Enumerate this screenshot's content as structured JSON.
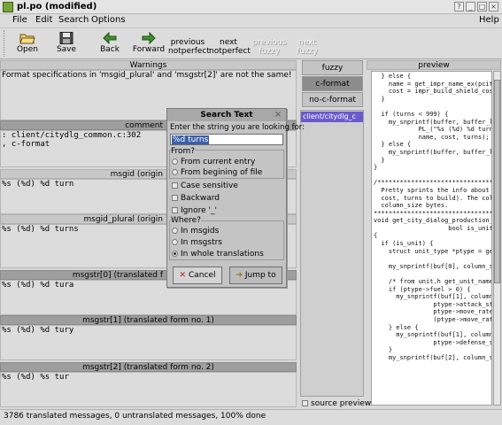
{
  "window": {
    "title": "pl.po (modified)",
    "buttons": [
      "?",
      "_",
      "□",
      "×"
    ]
  },
  "menubar": {
    "items": [
      {
        "label": "File"
      },
      {
        "label": "Edit"
      },
      {
        "label": "Search"
      },
      {
        "label": "Options"
      }
    ],
    "help": "Help"
  },
  "toolbar": {
    "open": "Open",
    "save": "Save",
    "back": "Back",
    "forward": "Forward",
    "prev_notperfect_1": "previous",
    "prev_notperfect_2": "notperfect",
    "next_notperfect_1": "next",
    "next_notperfect_2": "notperfect",
    "prev_fuzzy_1": "previous",
    "prev_fuzzy_2": "fuzzy",
    "next_fuzzy_1": "next",
    "next_fuzzy_2": "fuzzy"
  },
  "panes": {
    "warnings_header": "Warnings",
    "warnings_text": "Format specifications in 'msgid_plural' and 'msgstr[2]' are not the same!",
    "comments_header": "comment",
    "comment_line1": ": client/citydlg_common.c:302",
    "comment_line2": ", c-format",
    "msgid_header": "msgid (origin",
    "msgid_text": "%s (%d) %d turn",
    "msgid_plural_header": "msgid_plural (origin",
    "msgid_plural_text": "%s (%d) %d turns",
    "msgstr0_header": "msgstr[0] (translated f",
    "msgstr0_text": "%s (%d) %d tura",
    "msgstr1_header": "msgstr[1] (translated form no. 1)",
    "msgstr1_text": "%s (%d) %d tury",
    "msgstr2_header": "msgstr[2] (translated form no. 2)",
    "msgstr2_text": "%s (%d) %s tur"
  },
  "rightpanel": {
    "fuzzy": "fuzzy",
    "c_format": "c-format",
    "no_c_format": "no-c-format",
    "file_entry": "client/citydlg_c",
    "source_preview": "source preview",
    "preview_header": "preview",
    "preview_code": "  } else {\n    name = get_impr_name_ex(pcity,\n    cost = impr_build_shield_cost(id);\n  }\n\n  if (turns < 999) {\n    my_snprintf(buffer, buffer_len,\n            PL_(\"%s (%d) %d turn\", \"\n            name, cost, turns);\n  } else {\n    my_snprintf(buffer, buffer_len, \"%\n  }\n}\n\n/****************************************\n  Pretty sprints the info about a product\n  cost, turns to build). The columns mus\n  column_size bytes.\n****************************************\nvoid get_city_dialog_production_row(\n                    bool is_unit, stru\n{\n  if (is_unit) {\n    struct unit_type *ptype = get_unit_ty\n\n    my_snprintf(buf[0], column_size, un\n\n    /* from unit.h get_unit_name() */\n    if (ptype->fuel > 0) {\n      my_snprintf(buf[1], column_size, \"\n                ptype->attack_strength, pty\n                ptype->move_rate / 3,\n                (ptype->move_rate / 3) * pt\n    } else {\n      my_snprintf(buf[1], column_size, \"%\n                ptype->defense_strength,\n    }\n    my_snprintf(buf[2], column_size, \"%"
  },
  "dialog": {
    "title": "Search Text",
    "prompt": "Enter the string you are looking for:",
    "value": "%d turns",
    "from_label": "From?",
    "from_current": "From current entry",
    "from_beginning": "From begining of file",
    "case_sensitive": "Case sensitive",
    "backward": "Backward",
    "ignore": "Ignore '_'",
    "where_label": "Where?",
    "in_msgids": "In msgids",
    "in_msgstrs": "In msgstrs",
    "in_whole": "In whole translations",
    "cancel": "Cancel",
    "jump": "Jump to"
  },
  "statusbar": {
    "text": "3786 translated messages, 0 untranslated messages, 100% done"
  }
}
